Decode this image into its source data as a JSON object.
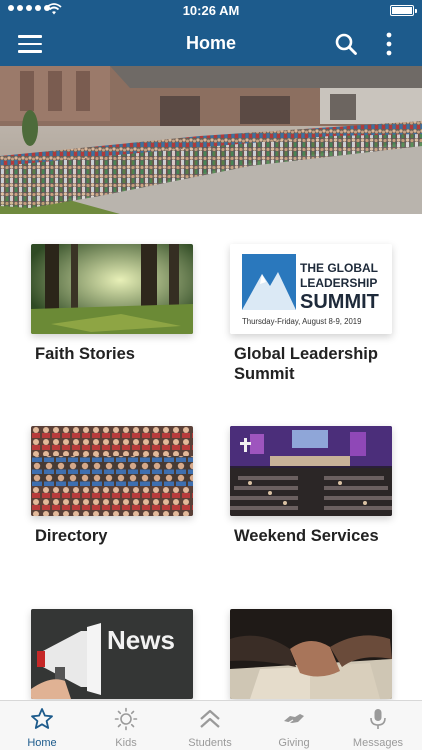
{
  "status_bar": {
    "time": "10:26 AM"
  },
  "header": {
    "title": "Home"
  },
  "tiles": [
    {
      "label": "Faith Stories"
    },
    {
      "label": "Global Leadership Summit"
    },
    {
      "label": "Directory"
    },
    {
      "label": "Weekend Services"
    },
    {
      "label": ""
    },
    {
      "label": ""
    }
  ],
  "summit_logo": {
    "line1": "THE GLOBAL",
    "line2": "LEADERSHIP",
    "line3": "SUMMIT",
    "dates": "Thursday-Friday, August 8-9, 2019"
  },
  "news_image": {
    "text": "News"
  },
  "tabs": [
    {
      "label": "Home",
      "icon": "star-icon",
      "active": true
    },
    {
      "label": "Kids",
      "icon": "sun-icon",
      "active": false
    },
    {
      "label": "Students",
      "icon": "chevrons-up-icon",
      "active": false
    },
    {
      "label": "Giving",
      "icon": "handshake-icon",
      "active": false
    },
    {
      "label": "Messages",
      "icon": "microphone-icon",
      "active": false
    }
  ],
  "colors": {
    "brand": "#1d5b8c",
    "tab_inactive": "#9a9a9a",
    "label_text": "#222222"
  }
}
